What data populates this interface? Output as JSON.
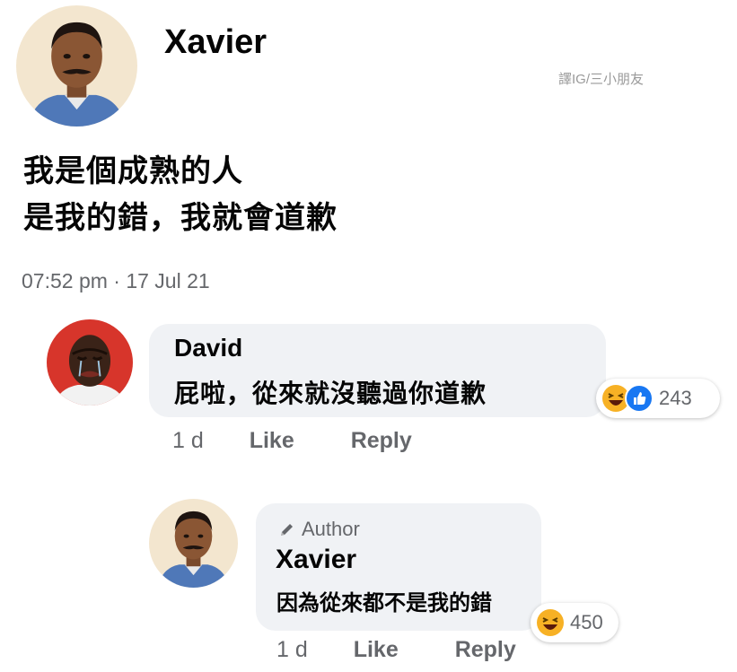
{
  "post": {
    "author": "Xavier",
    "watermark": "譯IG/三小朋友",
    "text_line1": "我是個成熟的人",
    "text_line2": "是我的錯，我就會道歉",
    "timestamp": "07:52 pm · 17 Jul 21"
  },
  "comments": [
    {
      "author": "David",
      "text": "屁啦，從來就沒聽過你道歉",
      "reaction_icons": [
        "haha-icon",
        "like-icon"
      ],
      "reaction_count": "243",
      "time": "1 d",
      "like_label": "Like",
      "reply_label": "Reply"
    },
    {
      "badge": "Author",
      "author": "Xavier",
      "text": "因為從來都不是我的錯",
      "reaction_icons": [
        "haha-icon"
      ],
      "reaction_count": "450",
      "time": "1 d",
      "like_label": "Like",
      "reply_label": "Reply"
    }
  ],
  "colors": {
    "bubble": "#f0f2f5",
    "secondary_text": "#65676b",
    "like_blue": "#1877f2",
    "haha_yellow": "#f7b125"
  }
}
